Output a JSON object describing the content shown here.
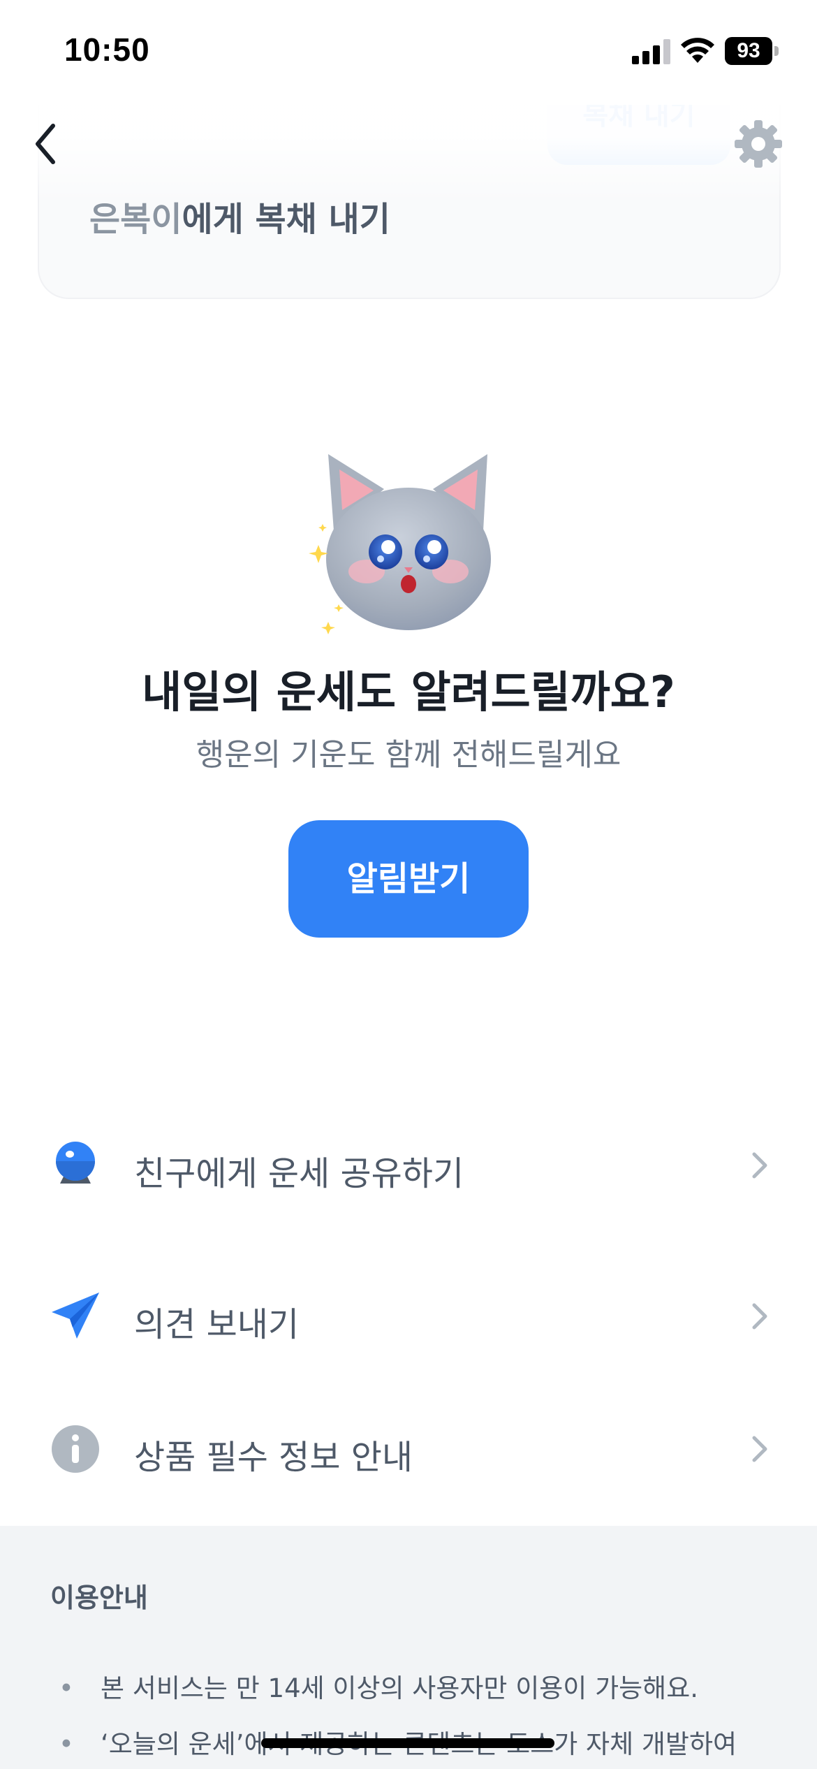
{
  "status_bar": {
    "time": "10:50",
    "battery": "93",
    "icons": [
      "signal-icon",
      "wifi-icon",
      "battery-icon"
    ]
  },
  "nav": {
    "back_icon": "chevron-left-icon",
    "settings_icon": "gear-icon"
  },
  "top_card": {
    "name": "은복이",
    "text_suffix": "에게 복채 내기",
    "button_label": "복채 내기"
  },
  "hero": {
    "title": "내일의 운세도 알려드릴까요?",
    "subtitle": "행운의 기운도 함께 전해드릴게요",
    "button_label": "알림받기"
  },
  "menu": [
    {
      "label": "친구에게 운세 공유하기",
      "icon": "crystal-ball-icon"
    },
    {
      "label": "의견 보내기",
      "icon": "paper-plane-icon"
    },
    {
      "label": "상품 필수 정보 안내",
      "icon": "info-icon"
    }
  ],
  "info": {
    "title": "이용안내",
    "lines": [
      "본 서비스는 만 14세 이상의 사용자만 이용이 가능해요.",
      "‘오늘의 운세’에서 제공하는 콘텐츠는 토스가 자체 개발하여"
    ]
  },
  "colors": {
    "accent": "#3182f6",
    "title": "#191f28",
    "subtext": "#6b7684",
    "footer_bg": "#f2f4f6"
  }
}
